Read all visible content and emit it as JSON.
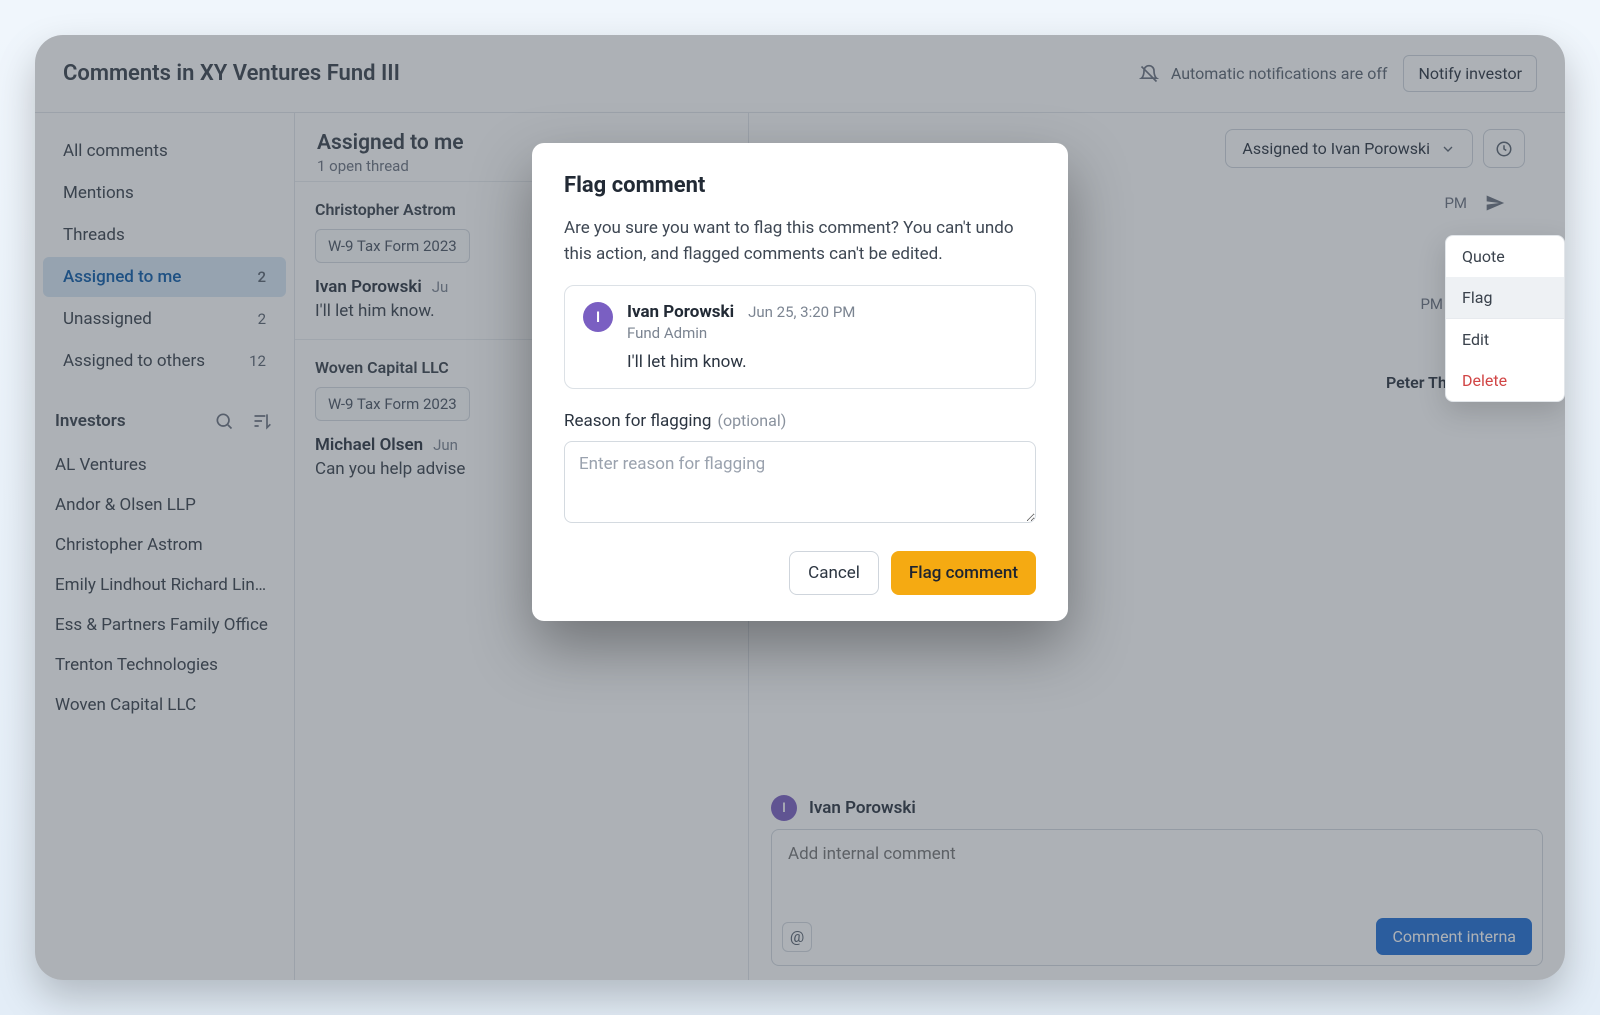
{
  "header": {
    "title": "Comments in XY Ventures Fund III",
    "notifications_text": "Automatic notifications are off",
    "notify_button": "Notify investor"
  },
  "sidebar": {
    "items": [
      {
        "label": "All comments",
        "count": ""
      },
      {
        "label": "Mentions",
        "count": ""
      },
      {
        "label": "Threads",
        "count": ""
      },
      {
        "label": "Assigned to me",
        "count": "2",
        "active": true
      },
      {
        "label": "Unassigned",
        "count": "2"
      },
      {
        "label": "Assigned to others",
        "count": "12"
      }
    ],
    "investors_heading": "Investors",
    "investors": [
      "AL Ventures",
      "Andor & Olsen LLP",
      "Christopher Astrom",
      "Emily Lindhout Richard Lindout...",
      "Ess & Partners Family Office",
      "Trenton Technologies",
      "Woven Capital LLC"
    ]
  },
  "mid": {
    "title": "Assigned to me",
    "subtitle": "1 open thread",
    "threads": [
      {
        "name": "Christopher Astrom",
        "chip": "W-9 Tax Form 2023",
        "msg_author": "Ivan Porowski",
        "msg_time": "Ju",
        "msg_body": "I'll let him know."
      },
      {
        "name": "Woven Capital LLC",
        "chip": "W-9 Tax Form 2023",
        "msg_author": "Michael Olsen",
        "msg_time": "Jun",
        "msg_body": "Can you help advise"
      }
    ]
  },
  "detail": {
    "assigned_label": "Assigned to Ivan Porowski",
    "ts1": "PM",
    "ts2": "PM",
    "mention_name": "Peter Thompson",
    "compose_user": "Ivan Porowski",
    "compose_placeholder": "Add internal comment",
    "compose_button": "Comment interna"
  },
  "context_menu": {
    "quote": "Quote",
    "flag": "Flag",
    "edit": "Edit",
    "delete": "Delete"
  },
  "modal": {
    "title": "Flag comment",
    "confirm": "Are you sure you want to flag this comment? You can't undo this action, and flagged comments can't be edited.",
    "user": "Ivan Porowski",
    "timestamp": "Jun 25, 3:20 PM",
    "role": "Fund Admin",
    "body": "I'll let him know.",
    "reason_label": "Reason for flagging",
    "reason_optional": "(optional)",
    "reason_placeholder": "Enter reason for flagging",
    "cancel": "Cancel",
    "submit": "Flag comment"
  }
}
